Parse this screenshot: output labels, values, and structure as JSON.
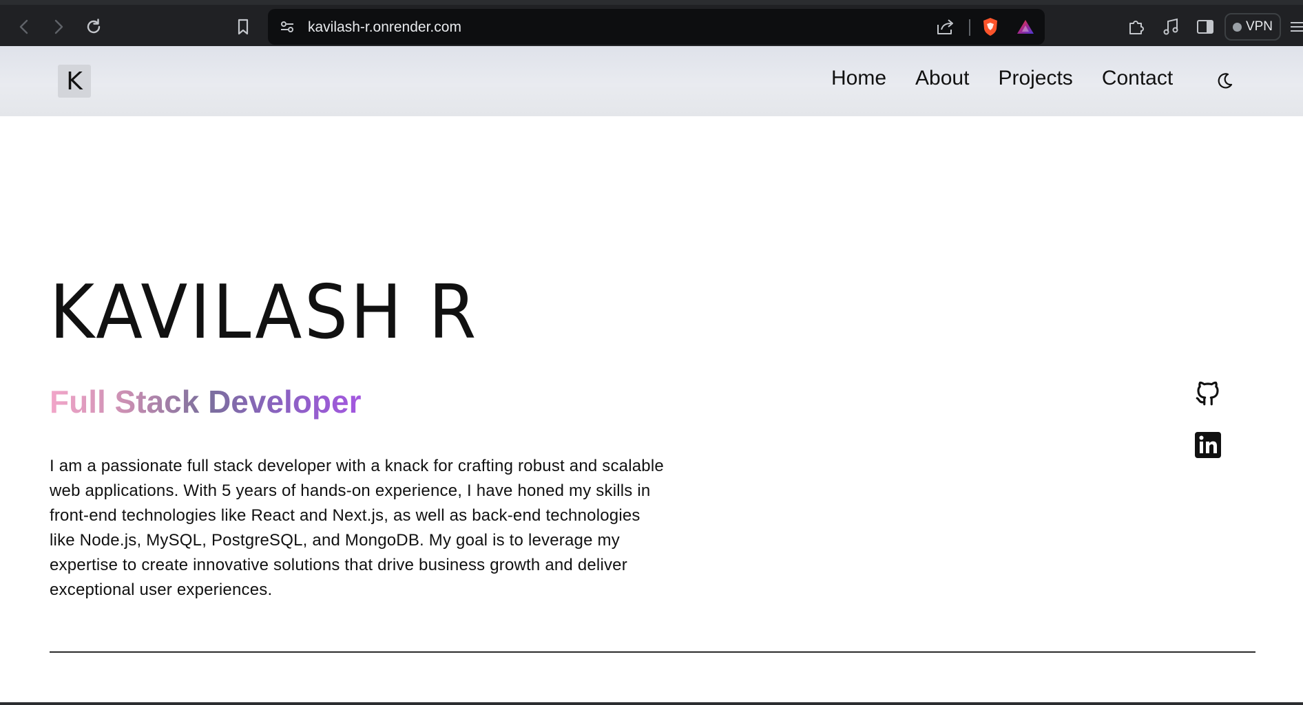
{
  "browser": {
    "url": "kavilash-r.onrender.com",
    "vpn_label": "VPN"
  },
  "site": {
    "logo_letter": "K",
    "nav": [
      "Home",
      "About",
      "Projects",
      "Contact"
    ]
  },
  "hero": {
    "name": "KAVILASH R",
    "role": "Full Stack Developer",
    "bio": "I am a passionate full stack developer with a knack for crafting robust and scalable web applications. With 5 years of hands-on experience, I have honed my skills in front-end technologies like React and Next.js, as well as back-end technologies like Node.js, MySQL, PostgreSQL, and MongoDB. My goal is to leverage my expertise to create innovative solutions that drive business growth and deliver exceptional user experiences."
  },
  "icons": {
    "back": "back-arrow-icon",
    "forward": "forward-arrow-icon",
    "reload": "reload-icon",
    "bookmark": "bookmark-icon",
    "site_settings": "site-settings-icon",
    "share": "share-icon",
    "brave_shield": "brave-shield-icon",
    "rewards": "brave-rewards-icon",
    "extensions": "extensions-icon",
    "media": "music-note-icon",
    "sidebar": "sidebar-icon",
    "theme": "moon-icon",
    "github": "github-icon",
    "linkedin": "linkedin-icon"
  },
  "colors": {
    "chrome_bg": "#202124",
    "header_bg": "#e6e8ee",
    "role_gradient_start": "#f2a6c9",
    "role_gradient_end": "#a457e0",
    "brave_orange": "#fb542b"
  }
}
